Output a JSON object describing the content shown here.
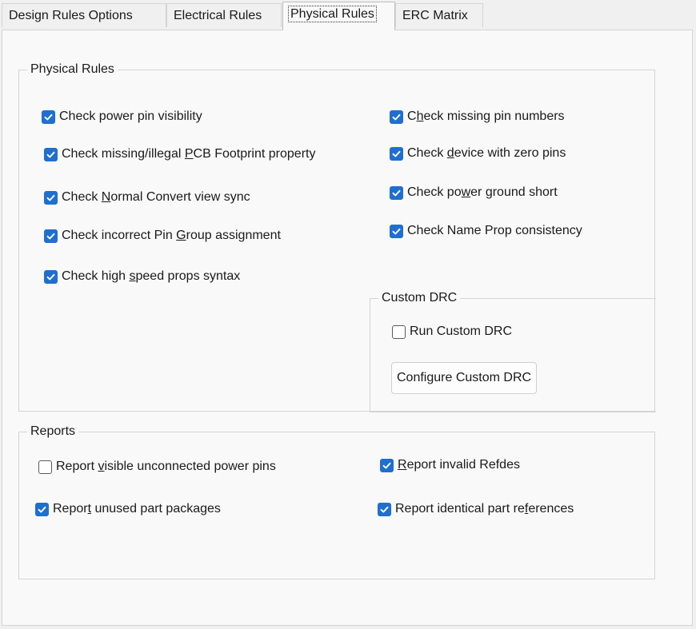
{
  "tabs": [
    {
      "label": "Design Rules Options",
      "active": false
    },
    {
      "label": "Electrical Rules",
      "active": false
    },
    {
      "label": "Physical Rules",
      "active": true
    },
    {
      "label": "ERC Matrix",
      "active": false
    }
  ],
  "physical_rules": {
    "title": "Physical Rules",
    "options": [
      {
        "pre": "Check power pin visibility",
        "u": "",
        "post": "",
        "checked": true
      },
      {
        "pre": "Check missing/illegal ",
        "u": "P",
        "post": "CB Footprint property",
        "checked": true
      },
      {
        "pre": "Check ",
        "u": "N",
        "post": "ormal Convert view sync",
        "checked": true
      },
      {
        "pre": "Check incorrect Pin ",
        "u": "G",
        "post": "roup assignment",
        "checked": true
      },
      {
        "pre": "Check high ",
        "u": "s",
        "post": "peed props syntax",
        "checked": true
      },
      {
        "pre": "C",
        "u": "h",
        "post": "eck missing pin numbers",
        "checked": true
      },
      {
        "pre": "Check ",
        "u": "d",
        "post": "evice with zero pins",
        "checked": true
      },
      {
        "pre": "Check po",
        "u": "w",
        "post": "er ground short",
        "checked": true
      },
      {
        "pre": "Check Name Prop consistency",
        "u": "",
        "post": "",
        "checked": true
      }
    ]
  },
  "custom_drc": {
    "title": "Custom DRC",
    "run_label": "Run Custom DRC",
    "run_checked": false,
    "configure_button": "Configure Custom DRC"
  },
  "reports": {
    "title": "Reports",
    "options": [
      {
        "pre": "Report ",
        "u": "v",
        "post": "isible unconnected power pins",
        "checked": false
      },
      {
        "pre": "Repor",
        "u": "t",
        "post": " unused part packages",
        "checked": true
      },
      {
        "pre": "",
        "u": "R",
        "post": "eport invalid Refdes",
        "checked": true
      },
      {
        "pre": "Report identical part re",
        "u": "f",
        "post": "erences",
        "checked": true
      }
    ]
  },
  "colors": {
    "checkbox_accent": "#1f6fd1",
    "panel_bg": "#f9f9f9",
    "window_bg": "#f0f0f0"
  },
  "icons": {
    "checked": "checkmark-icon"
  }
}
